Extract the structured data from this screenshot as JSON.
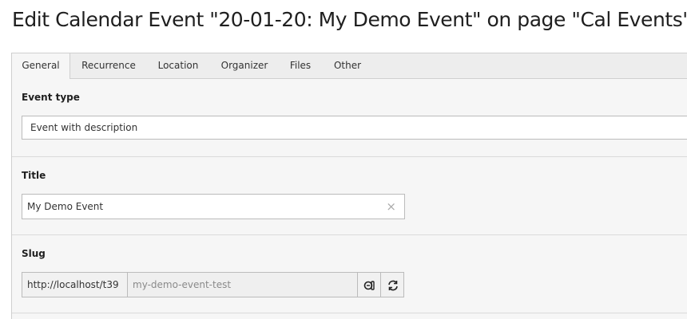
{
  "page": {
    "title": "Edit Calendar Event \"20-01-20: My Demo Event\" on page \"Cal Events\""
  },
  "tabs": [
    {
      "label": "General",
      "active": true
    },
    {
      "label": "Recurrence",
      "active": false
    },
    {
      "label": "Location",
      "active": false
    },
    {
      "label": "Organizer",
      "active": false
    },
    {
      "label": "Files",
      "active": false
    },
    {
      "label": "Other",
      "active": false
    }
  ],
  "fields": {
    "event_type": {
      "label": "Event type",
      "value": "Event with description"
    },
    "title": {
      "label": "Title",
      "value": "My Demo Event",
      "clear_icon": "close-icon"
    },
    "slug": {
      "label": "Slug",
      "prefix": "http://localhost/t39",
      "value": "my-demo-event-test",
      "edit_icon": "toggle-edit-icon",
      "refresh_icon": "refresh-icon"
    }
  },
  "colors": {
    "panel_bg": "#f6f6f6",
    "tab_bar_bg": "#ededed",
    "border": "#cfcfcf"
  }
}
